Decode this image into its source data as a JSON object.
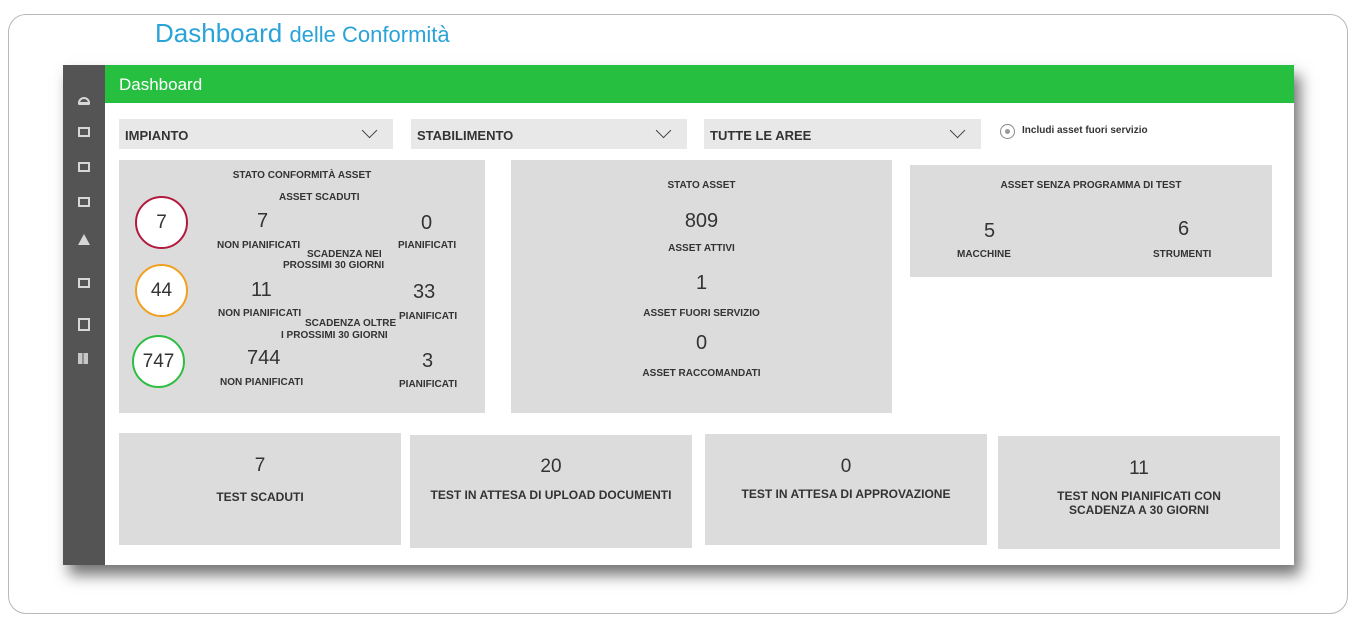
{
  "page": {
    "title": "Dashboard",
    "title_suffix": "delle Conformità"
  },
  "sidebar": {
    "icons": [
      "home-icon",
      "monitor-icon",
      "edit-icon",
      "calendar-icon",
      "flask-icon",
      "square-icon",
      "tablet-icon",
      "book-icon"
    ]
  },
  "topbar": {
    "title": "Dashboard"
  },
  "filters": {
    "impianto": "IMPIANTO",
    "stabilimento": "STABILIMENTO",
    "aree": "TUTTE LE AREE",
    "include_label": "Includi asset fuori servizio"
  },
  "compliance": {
    "title": "STATO CONFORMITÀ ASSET",
    "expired": {
      "heading": "ASSET SCADUTI",
      "total": "7",
      "unplanned": "7",
      "unplanned_label": "NON PIANIFICATI",
      "planned": "0",
      "planned_label": "PIANIFICATI",
      "color": "#b11a3c"
    },
    "due30": {
      "heading_1": "SCADENZA NEI",
      "heading_2": "PROSSIMI 30 GIORNI",
      "total": "44",
      "unplanned": "11",
      "unplanned_label": "NON PIANIFICATI",
      "planned": "33",
      "planned_label": "PIANIFICATI",
      "color": "#f0a01e"
    },
    "beyond30": {
      "heading_1": "SCADENZA OLTRE",
      "heading_2": "I PROSSIMI 30 GIORNI",
      "total": "747",
      "unplanned": "744",
      "unplanned_label": "NON PIANIFICATI",
      "planned": "3",
      "planned_label": "PIANIFICATI",
      "color": "#2ebd41"
    }
  },
  "asset_status": {
    "title": "STATO ASSET",
    "active": "809",
    "active_label": "ASSET ATTIVI",
    "out_of_service": "1",
    "out_of_service_label": "ASSET FUORI SERVIZIO",
    "recommended": "0",
    "recommended_label": "ASSET RACCOMANDATI"
  },
  "no_test_program": {
    "title": "ASSET SENZA PROGRAMMA DI TEST",
    "machines": "5",
    "machines_label": "MACCHINE",
    "instruments": "6",
    "instruments_label": "STRUMENTI"
  },
  "bottom_cards": [
    {
      "value": "7",
      "label": "TEST SCADUTI"
    },
    {
      "value": "20",
      "label": "TEST IN ATTESA DI UPLOAD DOCUMENTI"
    },
    {
      "value": "0",
      "label": "TEST IN ATTESA DI APPROVAZIONE"
    },
    {
      "value": "11",
      "label": "TEST NON PIANIFICATI CON SCADENZA A 30 GIORNI"
    }
  ]
}
